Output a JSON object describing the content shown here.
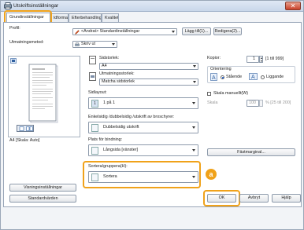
{
  "window": {
    "title": "Utskriftsinställningar",
    "close_label": "✕"
  },
  "tabs": [
    {
      "label": "Grundinställningar"
    },
    {
      "label": "ldformat"
    },
    {
      "label": "Efterbehandling"
    },
    {
      "label": "Kvalitet"
    }
  ],
  "profile": {
    "label": "Profil:",
    "value": "<Ändrat> Standardinställningar",
    "add_label": "Lägg till(1)...",
    "edit_label": "Redigera(2)..."
  },
  "output_method": {
    "label": "Utmatningsmetod:",
    "value": "Skriv ut"
  },
  "preview": {
    "status": "A4 [Skala: Auto]",
    "printer_settings_label": "Visningsinställningar",
    "defaults_label": "Standardvärden"
  },
  "page_size": {
    "label": "Sidstorlek:",
    "value": "A4"
  },
  "output_size": {
    "label": "Utmatningsstorlek:",
    "value": "Matcha sidstorlek"
  },
  "copies": {
    "label": "Kopior:",
    "value": "1",
    "range": "[1 till 999]"
  },
  "orientation": {
    "label": "Orientering",
    "portrait": "Stående",
    "landscape": "Liggande",
    "selected": "portrait"
  },
  "manual_scale": {
    "label": "Skala manuellt(W)",
    "scale_label": "Skala",
    "scale_value": "100",
    "scale_range": "% [25 till 200]"
  },
  "layout": {
    "label": "Sidlayout:",
    "value": "1 på 1"
  },
  "duplex": {
    "label": "Enkelsidig /dubbelsidig /utskrift av broschyrer:",
    "value": "Dubbelsidig utskrift"
  },
  "binding": {
    "label": "Plats för bindning:",
    "value": "Långsida [vänster]",
    "margin_button": "Fästmarginal..."
  },
  "collate": {
    "label": "Sortera/gruppera(H):",
    "value": "Sortera"
  },
  "callout": {
    "label": "a"
  },
  "footer": {
    "ok": "OK",
    "cancel": "Avbryt",
    "help": "Hjälp"
  },
  "colors": {
    "highlight": "#f0a21a",
    "accent": "#1a5ccf"
  }
}
